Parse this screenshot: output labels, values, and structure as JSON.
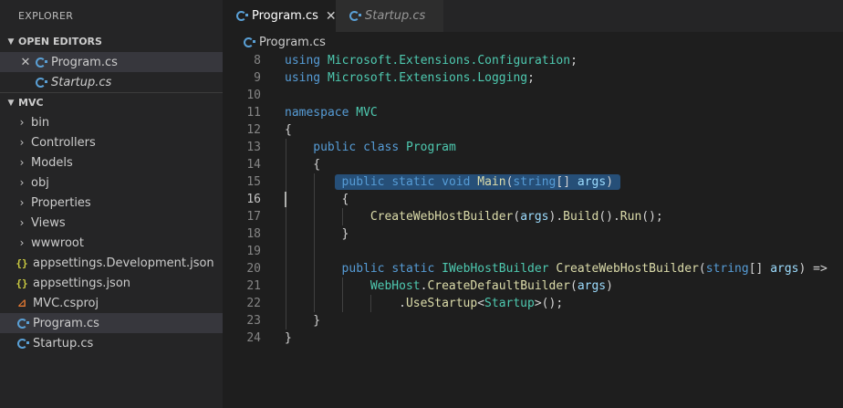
{
  "sidebar": {
    "title": "EXPLORER",
    "open_editors": {
      "header": "OPEN EDITORS",
      "items": [
        {
          "label": "Program.cs",
          "icon": "csharp-icon"
        },
        {
          "label": "Startup.cs",
          "icon": "csharp-icon"
        }
      ]
    },
    "project": {
      "header": "MVC",
      "folders": [
        "bin",
        "Controllers",
        "Models",
        "obj",
        "Properties",
        "Views",
        "wwwroot"
      ],
      "files": [
        {
          "label": "appsettings.Development.json",
          "icon": "json-icon"
        },
        {
          "label": "appsettings.json",
          "icon": "json-icon"
        },
        {
          "label": "MVC.csproj",
          "icon": "rss-icon"
        },
        {
          "label": "Program.cs",
          "icon": "csharp-icon"
        },
        {
          "label": "Startup.cs",
          "icon": "csharp-icon"
        }
      ]
    }
  },
  "tabs": [
    {
      "label": "Program.cs",
      "active": true
    },
    {
      "label": "Startup.cs",
      "active": false
    }
  ],
  "breadcrumb": "Program.cs",
  "code": {
    "active_line": 16,
    "lines": [
      {
        "n": "8",
        "indent": 0,
        "tokens": [
          [
            "kw",
            "using"
          ],
          [
            "t",
            " "
          ],
          [
            "ty",
            "Microsoft.Extensions.Configuration"
          ],
          [
            "t",
            ";"
          ]
        ]
      },
      {
        "n": "9",
        "indent": 0,
        "tokens": [
          [
            "kw",
            "using"
          ],
          [
            "t",
            " "
          ],
          [
            "ty",
            "Microsoft.Extensions.Logging"
          ],
          [
            "t",
            ";"
          ]
        ]
      },
      {
        "n": "10",
        "indent": 0,
        "tokens": []
      },
      {
        "n": "11",
        "indent": 0,
        "tokens": [
          [
            "kw",
            "namespace"
          ],
          [
            "t",
            " "
          ],
          [
            "ty",
            "MVC"
          ]
        ]
      },
      {
        "n": "12",
        "indent": 0,
        "tokens": [
          [
            "t",
            "{"
          ]
        ]
      },
      {
        "n": "13",
        "indent": 1,
        "tokens": [
          [
            "kw",
            "public"
          ],
          [
            "t",
            " "
          ],
          [
            "kw",
            "class"
          ],
          [
            "t",
            " "
          ],
          [
            "ty",
            "Program"
          ]
        ]
      },
      {
        "n": "14",
        "indent": 1,
        "tokens": [
          [
            "t",
            "{"
          ]
        ]
      },
      {
        "n": "15",
        "indent": 2,
        "highlight": true,
        "tokens": [
          [
            "kw",
            "public"
          ],
          [
            "t",
            " "
          ],
          [
            "kw",
            "static"
          ],
          [
            "t",
            " "
          ],
          [
            "kw",
            "void"
          ],
          [
            "t",
            " "
          ],
          [
            "fn",
            "Main"
          ],
          [
            "t",
            "("
          ],
          [
            "kw",
            "string"
          ],
          [
            "t",
            "[] "
          ],
          [
            "pm",
            "args"
          ],
          [
            "t",
            ")"
          ]
        ]
      },
      {
        "n": "16",
        "indent": 2,
        "tokens": [
          [
            "t",
            "{"
          ]
        ]
      },
      {
        "n": "17",
        "indent": 3,
        "tokens": [
          [
            "fn",
            "CreateWebHostBuilder"
          ],
          [
            "t",
            "("
          ],
          [
            "pm",
            "args"
          ],
          [
            "t",
            ")."
          ],
          [
            "fn",
            "Build"
          ],
          [
            "t",
            "()."
          ],
          [
            "fn",
            "Run"
          ],
          [
            "t",
            "();"
          ]
        ]
      },
      {
        "n": "18",
        "indent": 2,
        "tokens": [
          [
            "t",
            "}"
          ]
        ]
      },
      {
        "n": "19",
        "indent": 0,
        "tokens": []
      },
      {
        "n": "20",
        "indent": 2,
        "tokens": [
          [
            "kw",
            "public"
          ],
          [
            "t",
            " "
          ],
          [
            "kw",
            "static"
          ],
          [
            "t",
            " "
          ],
          [
            "ty",
            "IWebHostBuilder"
          ],
          [
            "t",
            " "
          ],
          [
            "fn",
            "CreateWebHostBuilder"
          ],
          [
            "t",
            "("
          ],
          [
            "kw",
            "string"
          ],
          [
            "t",
            "[] "
          ],
          [
            "pm",
            "args"
          ],
          [
            "t",
            ") =>"
          ]
        ]
      },
      {
        "n": "21",
        "indent": 3,
        "tokens": [
          [
            "ty",
            "WebHost"
          ],
          [
            "t",
            "."
          ],
          [
            "fn",
            "CreateDefaultBuilder"
          ],
          [
            "t",
            "("
          ],
          [
            "pm",
            "args"
          ],
          [
            "t",
            ")"
          ]
        ]
      },
      {
        "n": "22",
        "indent": 4,
        "tokens": [
          [
            "t",
            "."
          ],
          [
            "fn",
            "UseStartup"
          ],
          [
            "t",
            "<"
          ],
          [
            "ty",
            "Startup"
          ],
          [
            "t",
            ">();"
          ]
        ]
      },
      {
        "n": "23",
        "indent": 1,
        "tokens": [
          [
            "t",
            "}"
          ]
        ]
      },
      {
        "n": "24",
        "indent": 0,
        "tokens": [
          [
            "t",
            "}"
          ]
        ]
      }
    ]
  }
}
